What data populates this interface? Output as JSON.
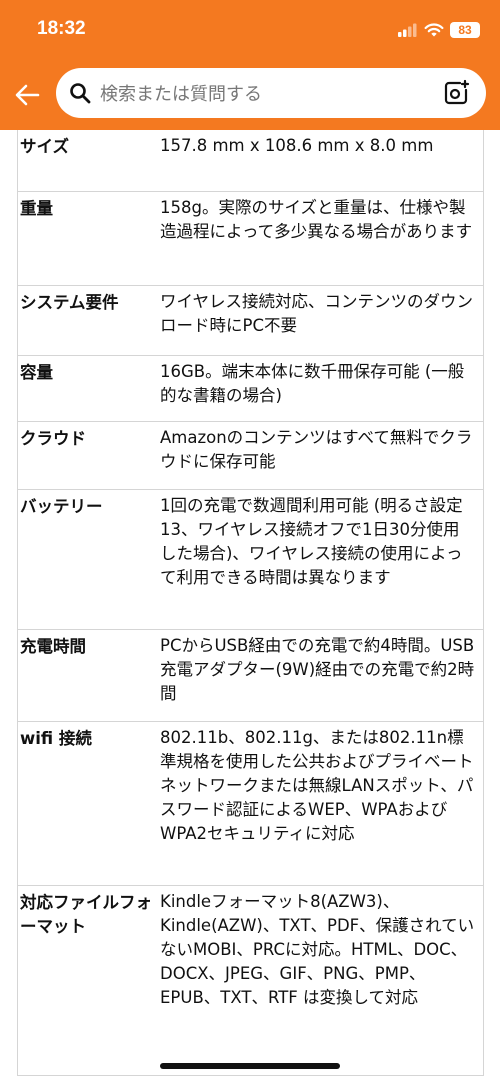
{
  "status_bar": {
    "time": "18:32",
    "battery": "83"
  },
  "search": {
    "placeholder": "検索または質問する"
  },
  "specs": [
    {
      "key": "サイズ",
      "value": "157.8 mm x 108.6 mm x 8.0 mm"
    },
    {
      "key": "重量",
      "value": "158g。実際のサイズと重量は、仕様や製造過程によって多少異なる場合があります"
    },
    {
      "key": "システム要件",
      "value": "ワイヤレス接続対応、コンテンツのダウンロード時にPC不要"
    },
    {
      "key": "容量",
      "value": "16GB。端末本体に数千冊保存可能 (一般的な書籍の場合)"
    },
    {
      "key": "クラウド",
      "value": "Amazonのコンテンツはすべて無料でクラウドに保存可能"
    },
    {
      "key": "バッテリー",
      "value": "1回の充電で数週間利用可能 (明るさ設定13、ワイヤレス接続オフで1日30分使用した場合)、ワイヤレス接続の使用によって利用できる時間は異なります"
    },
    {
      "key": "充電時間",
      "value": "PCからUSB経由での充電で約4時間。USB充電アダプター(9W)経由での充電で約2時間"
    },
    {
      "key": "wifi 接続",
      "value": "802.11b、802.11g、または802.11n標準規格を使用した公共およびプライベートネットワークまたは無線LANスポット、パスワード認証によるWEP、WPAおよびWPA2セキュリティに対応"
    },
    {
      "key": "対応ファイルフォーマット",
      "value": "Kindleフォーマット8(AZW3)、Kindle(AZW)、TXT、PDF、保護されていないMOBI、PRCに対応。HTML、DOC、DOCX、JPEG、GIF、PNG、PMP、EPUB、TXT、RTF は変換して対応"
    }
  ],
  "colors": {
    "accent": "#f47920",
    "divider": "#d5d5d5"
  },
  "icons": [
    "back-arrow-icon",
    "search-icon",
    "camera-icon",
    "signal-icon",
    "wifi-icon",
    "battery-icon"
  ]
}
